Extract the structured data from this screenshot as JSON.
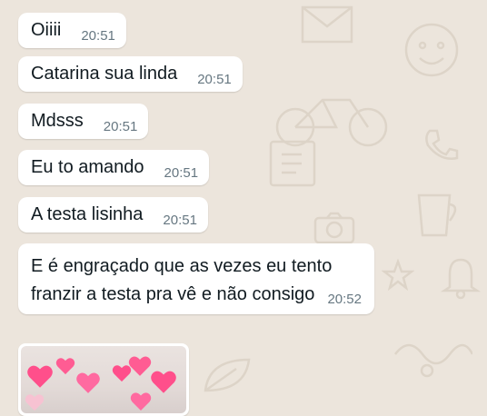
{
  "messages": [
    {
      "text": "Oiiii",
      "time": "20:51"
    },
    {
      "text": "Catarina sua linda",
      "time": "20:51"
    },
    {
      "text": "Mdsss",
      "time": "20:51"
    },
    {
      "text": "Eu to amando",
      "time": "20:51"
    },
    {
      "text": "A testa lisinha",
      "time": "20:51"
    },
    {
      "text": "E é engraçado que as vezes eu tento franzir a testa pra vê e não consigo",
      "time": "20:52"
    }
  ],
  "colors": {
    "wallpaper": "#ece5dc",
    "bubble": "#ffffff",
    "text": "#111b21",
    "time": "#667781",
    "heart": "#ff4f8b"
  },
  "icons": [
    "heart-icon"
  ]
}
